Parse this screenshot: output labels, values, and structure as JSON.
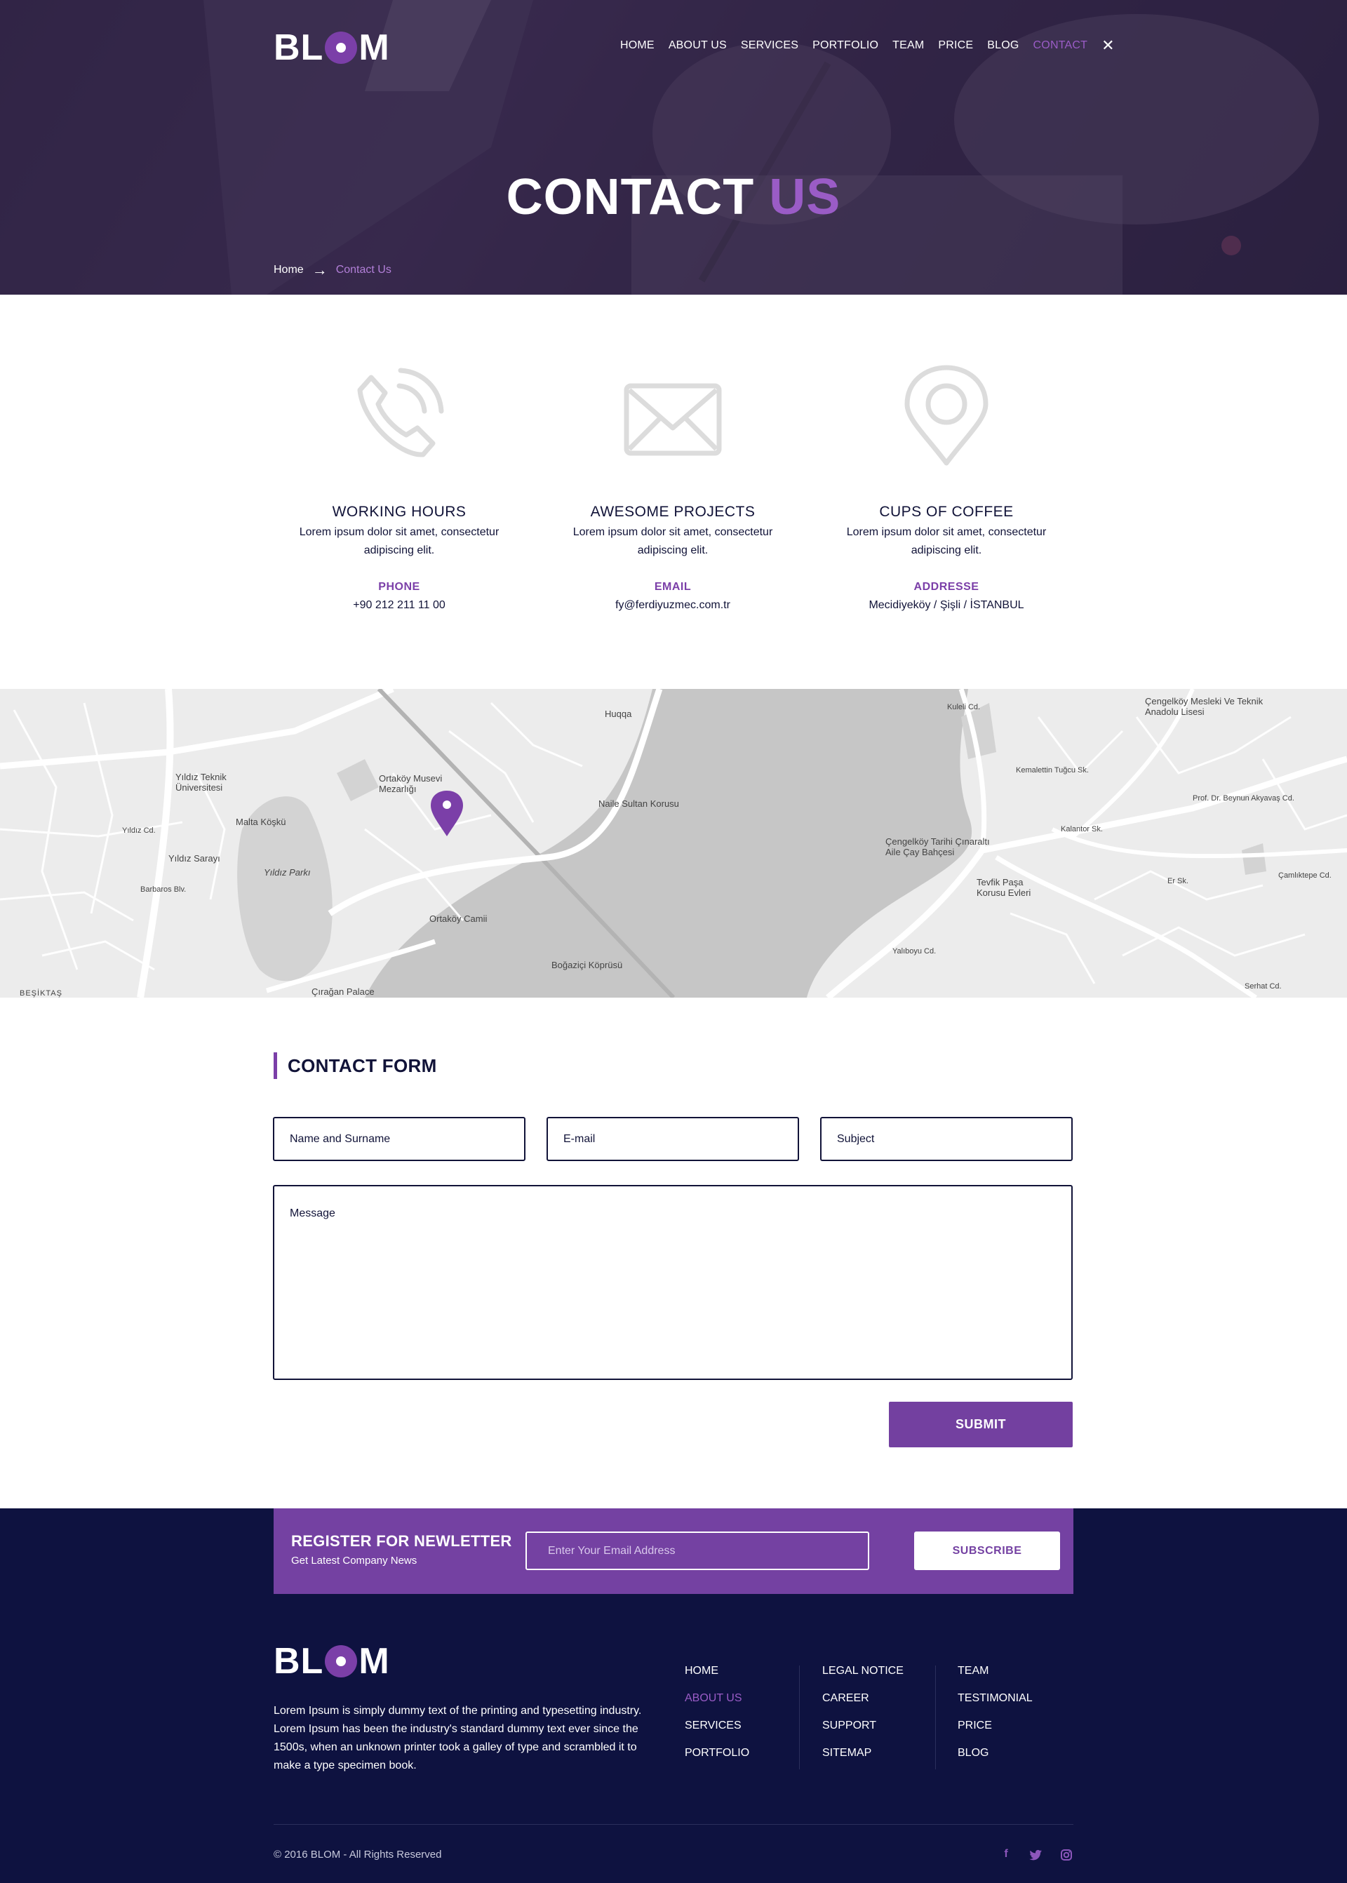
{
  "brand": {
    "logo_left": "BL",
    "logo_right": "M",
    "accent": "#7b3fa8",
    "dark": "#111338"
  },
  "nav": {
    "items": [
      "HOME",
      "ABOUT US",
      "SERVICES",
      "PORTFOLIO",
      "TEAM",
      "PRICE",
      "BLOG",
      "CONTACT"
    ],
    "active": "CONTACT",
    "close_icon": "close-icon"
  },
  "hero": {
    "title_main": "CONTACT",
    "title_accent": "US"
  },
  "breadcrumb": {
    "home": "Home",
    "current": "Contact Us"
  },
  "info": [
    {
      "icon": "phone-icon",
      "title": "WORKING HOURS",
      "desc": "Lorem ipsum dolor sit amet, consectetur adipiscing elit.",
      "label": "PHONE",
      "value": "+90 212 211 11 00"
    },
    {
      "icon": "envelope-icon",
      "title": "AWESOME PROJECTS",
      "desc": "Lorem ipsum dolor sit amet, consectetur adipiscing elit.",
      "label": "EMAIL",
      "value": "fy@ferdiyuzmec.com.tr"
    },
    {
      "icon": "location-pin-icon",
      "title": "CUPS OF COFFEE",
      "desc": "Lorem ipsum dolor sit amet, consectetur adipiscing elit.",
      "label": "ADDRESSE",
      "value": "Mecidiyeköy / Şişli / İSTANBUL"
    }
  ],
  "map": {
    "labels": [
      "Huqqa",
      "Naile Sultan Korusu",
      "Ortaköy Musevi Mezarlığı",
      "Yıldız Teknik Üniversitesi",
      "Malta Köşkü",
      "Yıldız Sarayı",
      "Yıldız Parkı",
      "Ortaköy Camii",
      "Boğaziçi Köprüsü",
      "Çırağan Palace",
      "Çengelköy Tarihi Çınaraltı Aile Çay Bahçesi",
      "Tevfik Paşa Korusu Evleri",
      "Çengelköy Mesleki Ve Teknik Anadolu Lisesi",
      "Prof. Dr. Beynun Akyavaş Cd.",
      "Kuleli Cd.",
      "BEŞİKTAŞ",
      "Barbaros Blv.",
      "Yıldız Cd.",
      "Kemalettin Tuğcu Sk.",
      "Kalantor Sk.",
      "Yalıboyu Cd.",
      "Çamlıktepe Cd.",
      "Er Sk.",
      "Serhat Cd."
    ]
  },
  "form": {
    "title": "CONTACT FORM",
    "name_placeholder": "Name and Surname",
    "email_placeholder": "E-mail",
    "subject_placeholder": "Subject",
    "message_placeholder": "Message",
    "submit": "SUBMIT"
  },
  "newsletter": {
    "title": "REGISTER FOR NEWLETTER",
    "subtitle": "Get Latest Company News",
    "placeholder": "Enter Your Email Address",
    "button": "SUBSCRIBE"
  },
  "footer": {
    "about": "Lorem Ipsum is simply dummy text of the printing and typesetting industry. Lorem Ipsum has been the industry's standard dummy text ever since the 1500s, when an unknown printer took a galley of type and scrambled it to make a type specimen book.",
    "col1": [
      "HOME",
      "ABOUT US",
      "SERVICES",
      "PORTFOLIO"
    ],
    "col1_active": "ABOUT US",
    "col2": [
      "LEGAL NOTICE",
      "CAREER",
      "SUPPORT",
      "SITEMAP"
    ],
    "col3": [
      "TEAM",
      "TESTIMONIAL",
      "PRICE",
      "BLOG"
    ],
    "copyright": "© 2016 BLOM - All Rights Reserved",
    "social": [
      "facebook-icon",
      "twitter-icon",
      "instagram-icon"
    ]
  }
}
